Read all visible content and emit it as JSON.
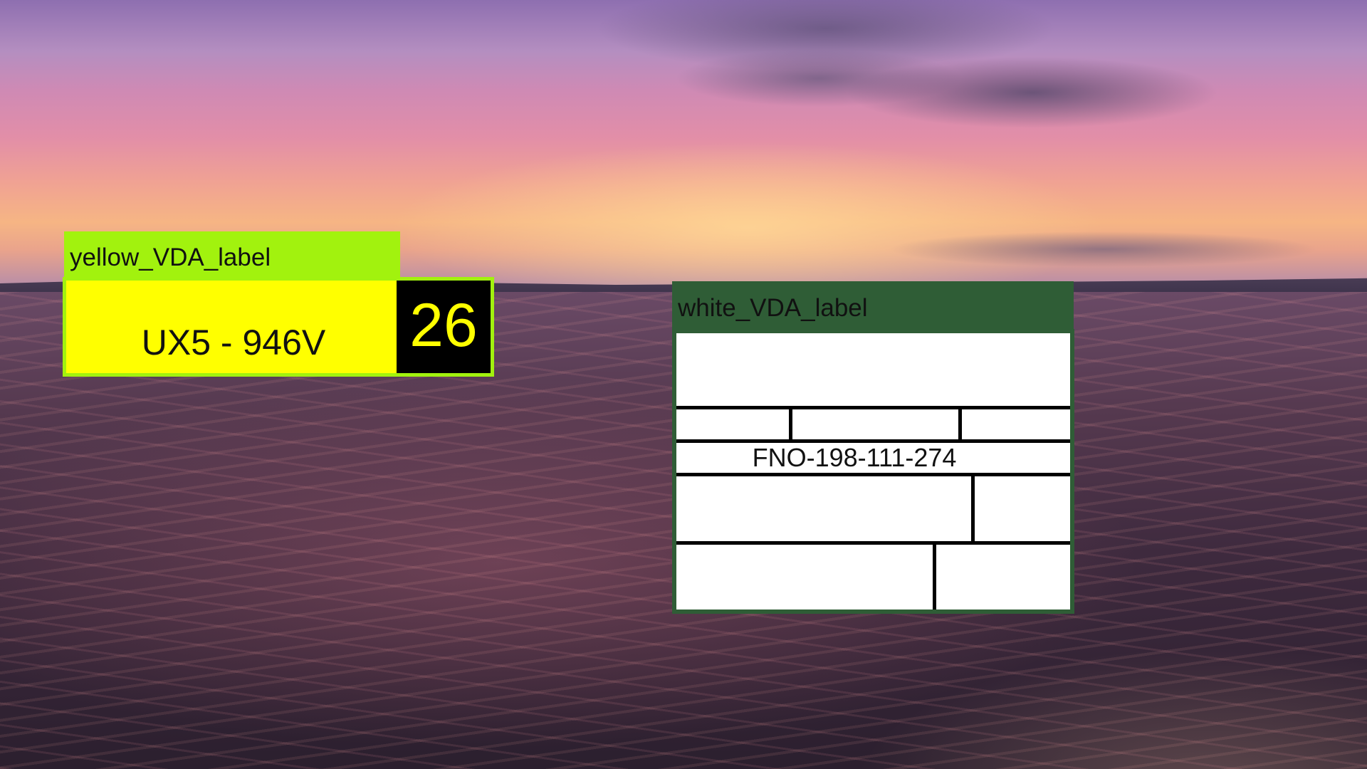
{
  "yellow_label": {
    "tag": "yellow_VDA_label",
    "code": "UX5 - 946V",
    "number": "26",
    "colors": {
      "tag": "#a2f20e",
      "body": "#ffff00",
      "number_bg": "#000000",
      "number_fg": "#ffff00"
    }
  },
  "white_label": {
    "tag": "white_VDA_label",
    "code": "FNO-198-111-274",
    "colors": {
      "tag": "#2f5d36",
      "body": "#ffffff"
    }
  }
}
